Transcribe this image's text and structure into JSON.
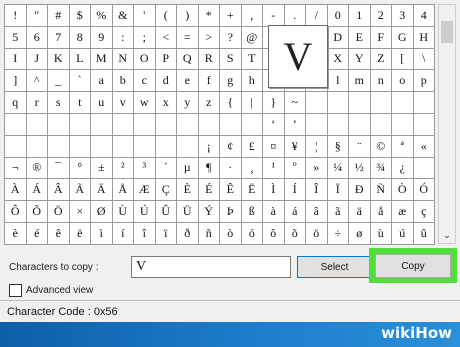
{
  "grid": {
    "rows": [
      [
        "!",
        "\"",
        "#",
        "$",
        "%",
        "&",
        "'",
        "(",
        ")",
        "*",
        "+",
        ",",
        "-",
        ".",
        "/",
        "0",
        "1",
        "2",
        "3",
        "4"
      ],
      [
        "5",
        "6",
        "7",
        "8",
        "9",
        ":",
        ";",
        "<",
        "=",
        ">",
        "?",
        "@",
        "",
        "",
        "C",
        "D",
        "E",
        "F",
        "G",
        "H"
      ],
      [
        "I",
        "J",
        "K",
        "L",
        "M",
        "N",
        "O",
        "P",
        "Q",
        "R",
        "S",
        "T",
        "",
        "",
        "W",
        "X",
        "Y",
        "Z",
        "[",
        "\\"
      ],
      [
        "]",
        "^",
        "_",
        "`",
        "a",
        "b",
        "c",
        "d",
        "e",
        "f",
        "g",
        "h",
        "",
        "",
        "k",
        "l",
        "m",
        "n",
        "o",
        "p"
      ],
      [
        "q",
        "r",
        "s",
        "t",
        "u",
        "v",
        "w",
        "x",
        "y",
        "z",
        "{",
        "|",
        "}",
        "~",
        "",
        "",
        "",
        "",
        "",
        ""
      ],
      [
        "",
        "",
        "",
        "",
        "",
        "",
        "",
        "",
        "",
        "",
        "",
        "",
        "‘",
        "’",
        "",
        "",
        "",
        "",
        "",
        ""
      ],
      [
        "",
        "",
        "",
        "",
        "",
        "",
        "",
        "",
        "",
        "¡",
        "¢",
        "£",
        "¤",
        "¥",
        "¦",
        "§",
        "¨",
        "©",
        "ª",
        "«"
      ],
      [
        "¬",
        "®",
        "¯",
        "°",
        "±",
        "²",
        "³",
        "´",
        "µ",
        "¶",
        "·",
        "¸",
        "¹",
        "º",
        "»",
        "¼",
        "½",
        "¾",
        "¿",
        ""
      ],
      [
        "À",
        "Á",
        "Â",
        "Ã",
        "Ä",
        "Å",
        "Æ",
        "Ç",
        "È",
        "É",
        "Ê",
        "Ë",
        "Ì",
        "Í",
        "Î",
        "Ï",
        "Ð",
        "Ñ",
        "Ò",
        "Ó"
      ],
      [
        "Ô",
        "Õ",
        "Ö",
        "×",
        "Ø",
        "Ù",
        "Ú",
        "Û",
        "Ü",
        "Ý",
        "Þ",
        "ß",
        "à",
        "á",
        "â",
        "ã",
        "ä",
        "å",
        "æ",
        "ç"
      ],
      [
        "è",
        "é",
        "ê",
        "ë",
        "ì",
        "í",
        "î",
        "ï",
        "ð",
        "ñ",
        "ò",
        "ó",
        "ô",
        "õ",
        "ö",
        "÷",
        "ø",
        "ù",
        "ú",
        "û"
      ]
    ]
  },
  "magnifier": {
    "char": "V"
  },
  "copy": {
    "label": "Characters to copy :",
    "value": "V",
    "select_label": "Select",
    "copy_label": "Copy"
  },
  "advanced": {
    "label": "Advanced view",
    "checked": false
  },
  "status": {
    "text": "Character Code : 0x56"
  },
  "scrollbar": {
    "down_arrow": "⌄"
  },
  "watermark": {
    "text": "wikiHow"
  },
  "colors": {
    "highlight": "#52dd3c",
    "taskbar": "#1f7fcf"
  }
}
